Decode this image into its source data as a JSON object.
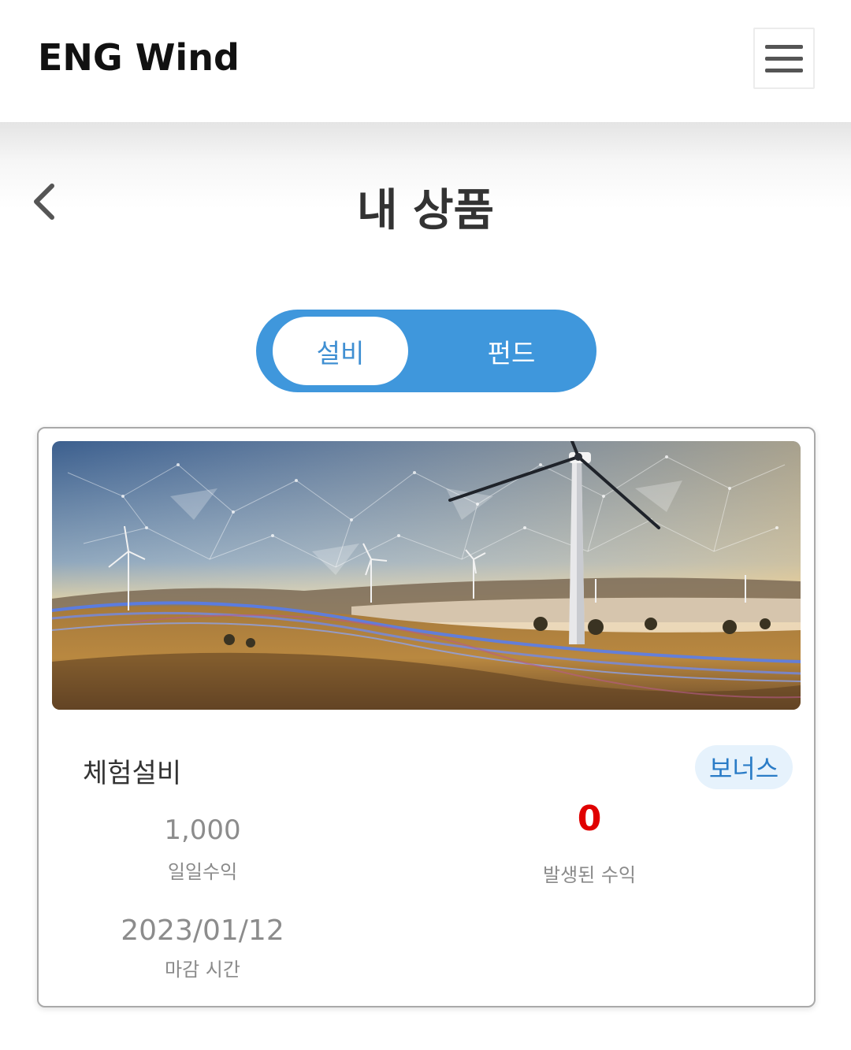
{
  "header": {
    "brand": "ENG Wind",
    "menu_icon": "hamburger-menu-icon"
  },
  "page": {
    "back_icon": "chevron-left-icon",
    "title": "내 상품"
  },
  "tabs": {
    "items": [
      {
        "label": "설비",
        "active": true
      },
      {
        "label": "펀드",
        "active": false
      }
    ],
    "accent_color": "#3f97dc"
  },
  "product": {
    "image": "wind-turbines-banner",
    "name": "체험설비",
    "badge": "보너스",
    "daily_income": {
      "value": "1,000",
      "label": "일일수익"
    },
    "earned_income": {
      "value": "0",
      "label": "발생된 수익",
      "color": "#e00000"
    },
    "deadline": {
      "value": "2023/01/12",
      "label": "마감 시간"
    }
  }
}
